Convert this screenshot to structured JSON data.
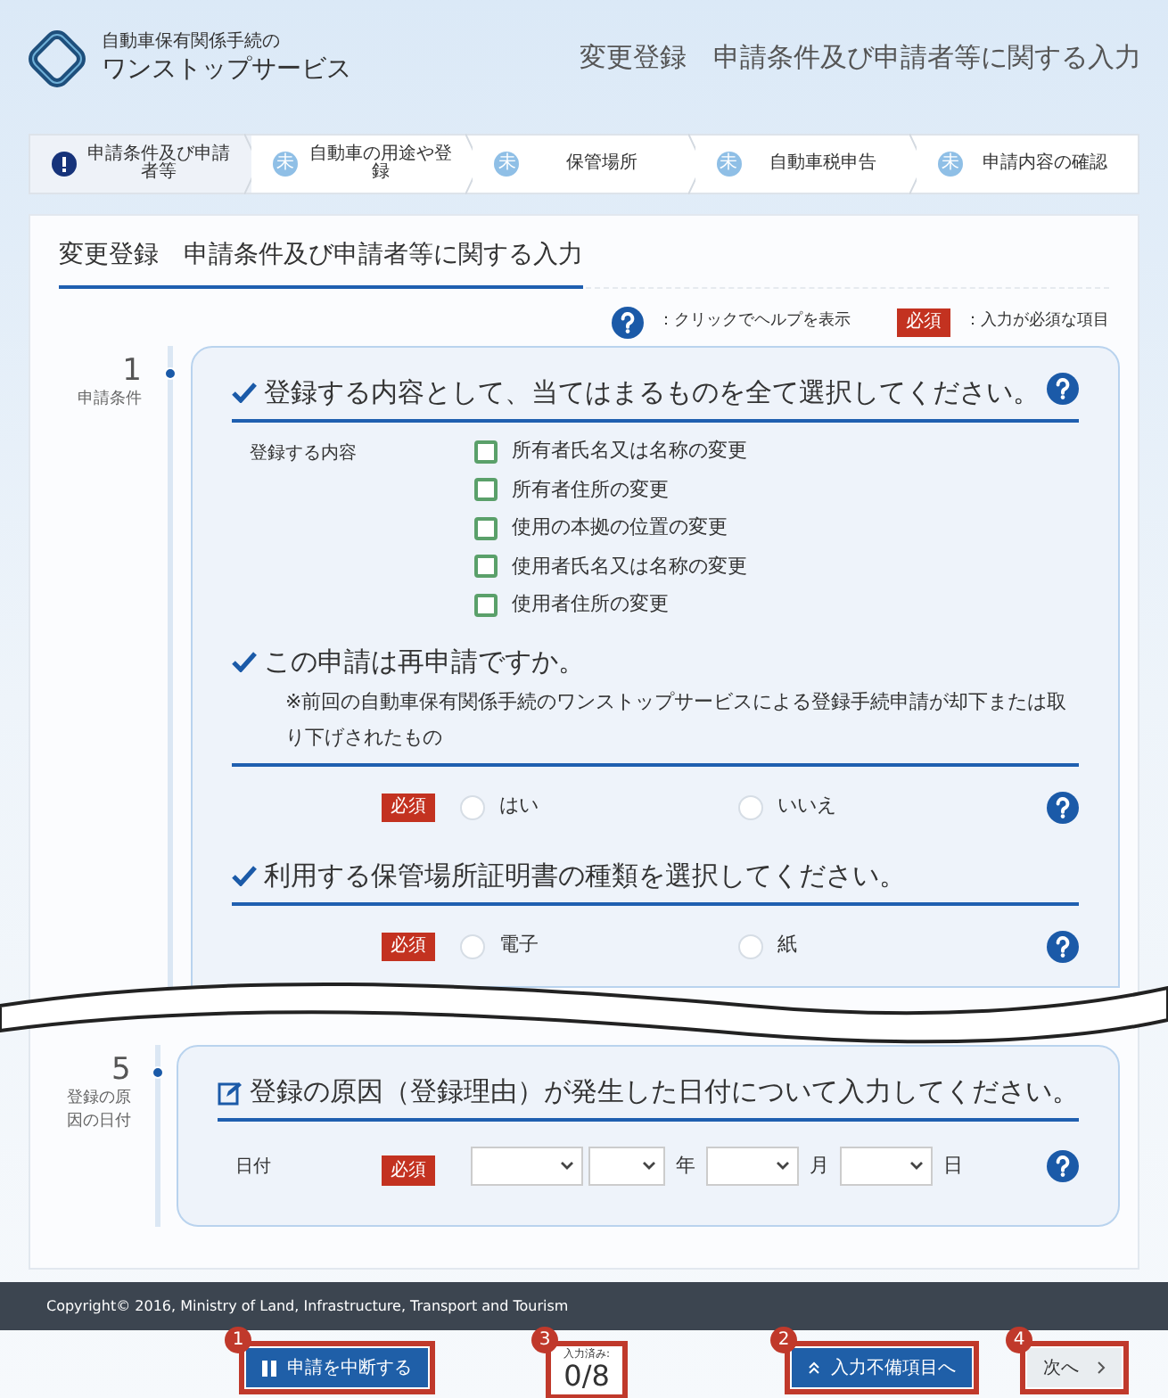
{
  "header": {
    "logo_line1": "自動車保有関係手続の",
    "logo_line2": "ワンストップサービス",
    "page_title": "変更登録　申請条件及び申請者等に関する入力"
  },
  "steps": [
    {
      "label": "申請条件及び申請者等",
      "selected": true
    },
    {
      "label": "自動車の用途や登録",
      "selected": false,
      "badge": "未"
    },
    {
      "label": "保管場所",
      "selected": false,
      "badge": "未"
    },
    {
      "label": "自動車税申告",
      "selected": false,
      "badge": "未"
    },
    {
      "label": "申請内容の確認",
      "selected": false,
      "badge": "未"
    }
  ],
  "form": {
    "title": "変更登録　申請条件及び申請者等に関する入力",
    "legend": {
      "help_text": "：クリックでヘルプを表示",
      "required_badge": "必須",
      "required_text": "：入力が必須な項目"
    },
    "sections": [
      {
        "number": "1",
        "label": "申請条件",
        "questions": [
          {
            "kind": "checkboxes",
            "heading": "登録する内容として、当てはまるものを全て選択してください。",
            "field_label": "登録する内容",
            "options": [
              {
                "label": "所有者氏名又は名称の変更",
                "checked": false
              },
              {
                "label": "所有者住所の変更",
                "checked": false
              },
              {
                "label": "使用の本拠の位置の変更",
                "checked": false
              },
              {
                "label": "使用者氏名又は名称の変更",
                "checked": false
              },
              {
                "label": "使用者住所の変更",
                "checked": false
              }
            ]
          },
          {
            "kind": "radio",
            "heading": "この申請は再申請ですか。",
            "note": "※前回の自動車保有関係手続のワンストップサービスによる登録手続申請が却下または取り下げされたもの",
            "required": "必須",
            "options": [
              {
                "label": "はい",
                "selected": false
              },
              {
                "label": "いいえ",
                "selected": false
              }
            ]
          },
          {
            "kind": "radio",
            "heading": "利用する保管場所証明書の種類を選択してください。",
            "required": "必須",
            "options": [
              {
                "label": "電子",
                "selected": false
              },
              {
                "label": "紙",
                "selected": false
              }
            ]
          }
        ]
      },
      {
        "number": "5",
        "label": "登録の原因の日付",
        "questions": [
          {
            "kind": "date",
            "heading": "登録の原因（登録理由）が発生した日付について入力してください。",
            "field_label": "日付",
            "required": "必須",
            "units": [
              "年",
              "月",
              "日"
            ]
          }
        ]
      }
    ]
  },
  "footer": {
    "copyright": "Copyright© 2016, Ministry of Land, Infrastructure, Transport and Tourism"
  },
  "actions": [
    {
      "kind": "suspend",
      "label": "申請を中断する",
      "callout": "1"
    },
    {
      "kind": "progress",
      "caption": "入力済み:",
      "value": "0/8",
      "callout": "3"
    },
    {
      "kind": "jump",
      "label": "入力不備項目へ",
      "callout": "2"
    },
    {
      "kind": "next",
      "label": "次へ",
      "callout": "4"
    }
  ]
}
